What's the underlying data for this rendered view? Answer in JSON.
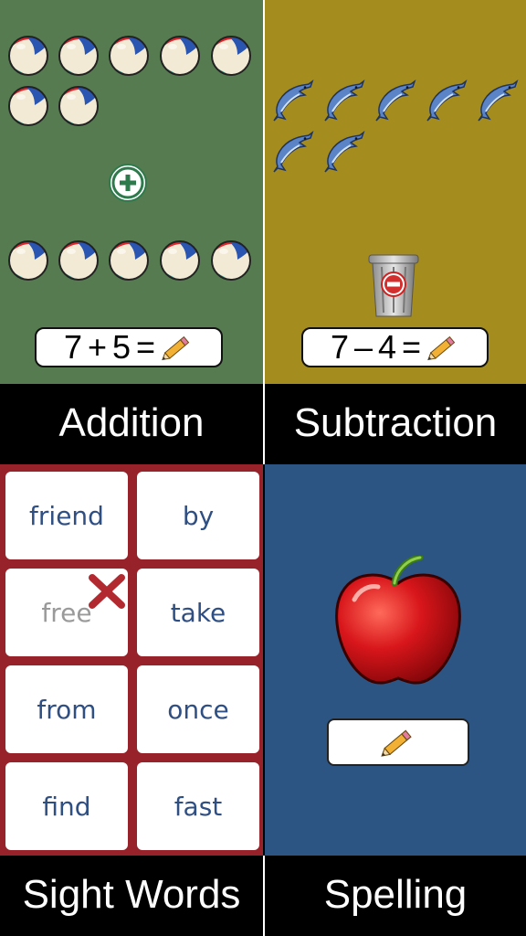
{
  "addition": {
    "label": "Addition",
    "equation": {
      "left": "7",
      "op": "+",
      "right": "5",
      "eq": "="
    },
    "top_balls": 7,
    "bottom_balls": 5,
    "icon": "plus-circle-icon",
    "bg": "#567b50"
  },
  "subtraction": {
    "label": "Subtraction",
    "equation": {
      "left": "7",
      "op": "–",
      "right": "4",
      "eq": "="
    },
    "dolphins": 7,
    "icon": "trash-minus-icon",
    "bg": "#a58c1f"
  },
  "sight_words": {
    "label": "Sight Words",
    "words": [
      {
        "text": "friend",
        "disabled": false
      },
      {
        "text": "by",
        "disabled": false
      },
      {
        "text": "free",
        "disabled": true
      },
      {
        "text": "take",
        "disabled": false
      },
      {
        "text": "from",
        "disabled": false
      },
      {
        "text": "once",
        "disabled": false
      },
      {
        "text": "find",
        "disabled": false
      },
      {
        "text": "fast",
        "disabled": false
      }
    ],
    "bg": "#97222a"
  },
  "spelling": {
    "label": "Spelling",
    "picture": "apple",
    "bg": "#2c5584"
  }
}
